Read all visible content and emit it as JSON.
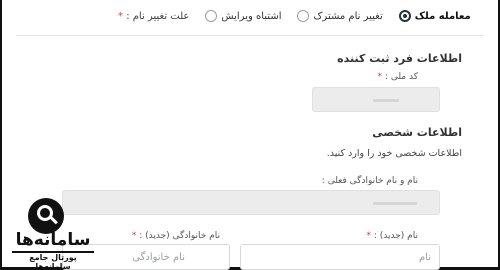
{
  "reason": {
    "label": "علت تغییر نام :",
    "required_mark": "*",
    "options": [
      {
        "label": "اشتباه ویرایش",
        "checked": false
      },
      {
        "label": "تغییر نام مشترک",
        "checked": false
      },
      {
        "label": "معامله ملک",
        "checked": true
      }
    ]
  },
  "registrant": {
    "title": "اطلاعات فرد ثبت کننده",
    "national_code_label": "کد ملی :",
    "required_mark": "*"
  },
  "personal": {
    "title": "اطلاعات شخصی",
    "hint": "اطلاعات شخصی خود را وارد کنید.",
    "current_name_label": "نام و نام خانوادگی فعلی :",
    "new_first_name_label": "نام (جدید) :",
    "new_first_name_placeholder": "نام",
    "new_last_name_label": "نام خانوادگی (جدید) :",
    "new_last_name_placeholder": "نام خانوادگی",
    "required_mark": "*"
  },
  "watermark": {
    "brand": "سامانه‌ها",
    "subtitle": "پورتال جامع سامانه‌ها"
  }
}
